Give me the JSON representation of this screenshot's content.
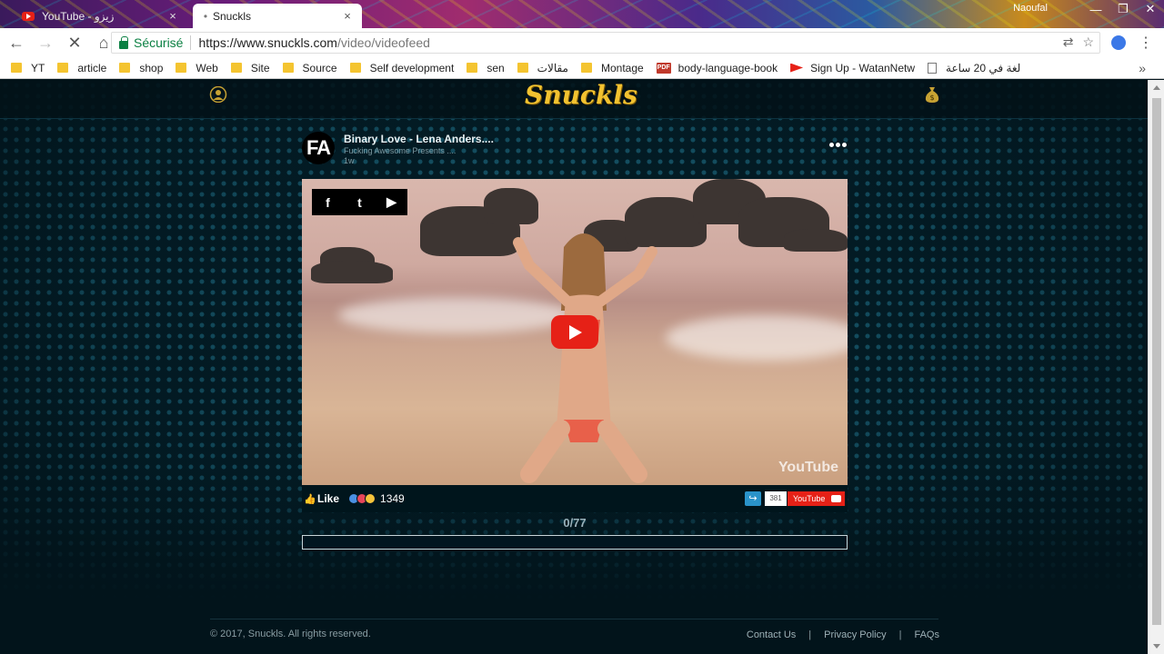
{
  "browser": {
    "tabs": [
      {
        "title": "YouTube - زيزو",
        "close": "×",
        "active": false
      },
      {
        "title": "Snuckls",
        "close": "×",
        "active": true
      }
    ],
    "profile_name": "Naoufal",
    "window_controls": {
      "minimize": "—",
      "maximize": "❐",
      "close": "✕"
    },
    "nav": {
      "back": "←",
      "forward": "→",
      "stop": "✕",
      "home": "⌂"
    },
    "security_label": "Sécurisé",
    "url_host": "https://www.snuckls.com",
    "url_path": "/video/videofeed",
    "bookmarks": [
      {
        "label": "YT",
        "icon": "folder-icon"
      },
      {
        "label": "article",
        "icon": "folder-icon"
      },
      {
        "label": "shop",
        "icon": "folder-icon"
      },
      {
        "label": "Web",
        "icon": "folder-icon"
      },
      {
        "label": "Site",
        "icon": "folder-icon"
      },
      {
        "label": "Source",
        "icon": "folder-icon"
      },
      {
        "label": "Self development",
        "icon": "folder-icon"
      },
      {
        "label": "sen",
        "icon": "folder-icon"
      },
      {
        "label": "مقالات",
        "icon": "folder-icon"
      },
      {
        "label": "Montage",
        "icon": "folder-icon"
      },
      {
        "label": "body-language-book",
        "icon": "pdf-icon"
      },
      {
        "label": "Sign Up - WatanNetw",
        "icon": "youtube-icon"
      },
      {
        "label": "لغة في 20 ساعة",
        "icon": "document-icon"
      }
    ],
    "bookmarks_more": "»"
  },
  "site": {
    "logo": "Snuckls",
    "post": {
      "avatar_text": "FA",
      "title": "Binary Love - Lena Anders....",
      "subtitle": "Fucking Awesome Presents ....",
      "time": "1w"
    },
    "video": {
      "share": {
        "facebook": "f",
        "twitter": "t",
        "youtube": "▶"
      },
      "watermark": "YouTube"
    },
    "actions": {
      "like_label": "Like",
      "reaction_count": "1349",
      "subscriber_count": "381",
      "youtube_button": "YouTube"
    },
    "progress": {
      "counter": "0/77",
      "fraction": 0
    },
    "footer": {
      "copyright": "© 2017, Snuckls. All rights reserved.",
      "links": [
        "Contact Us",
        "Privacy Policy",
        "FAQs"
      ],
      "separator": "|"
    }
  },
  "colors": {
    "logo": "#f2c230",
    "youtube_red": "#e62117",
    "secure_green": "#0b8043",
    "page_bg": "#031d26"
  }
}
